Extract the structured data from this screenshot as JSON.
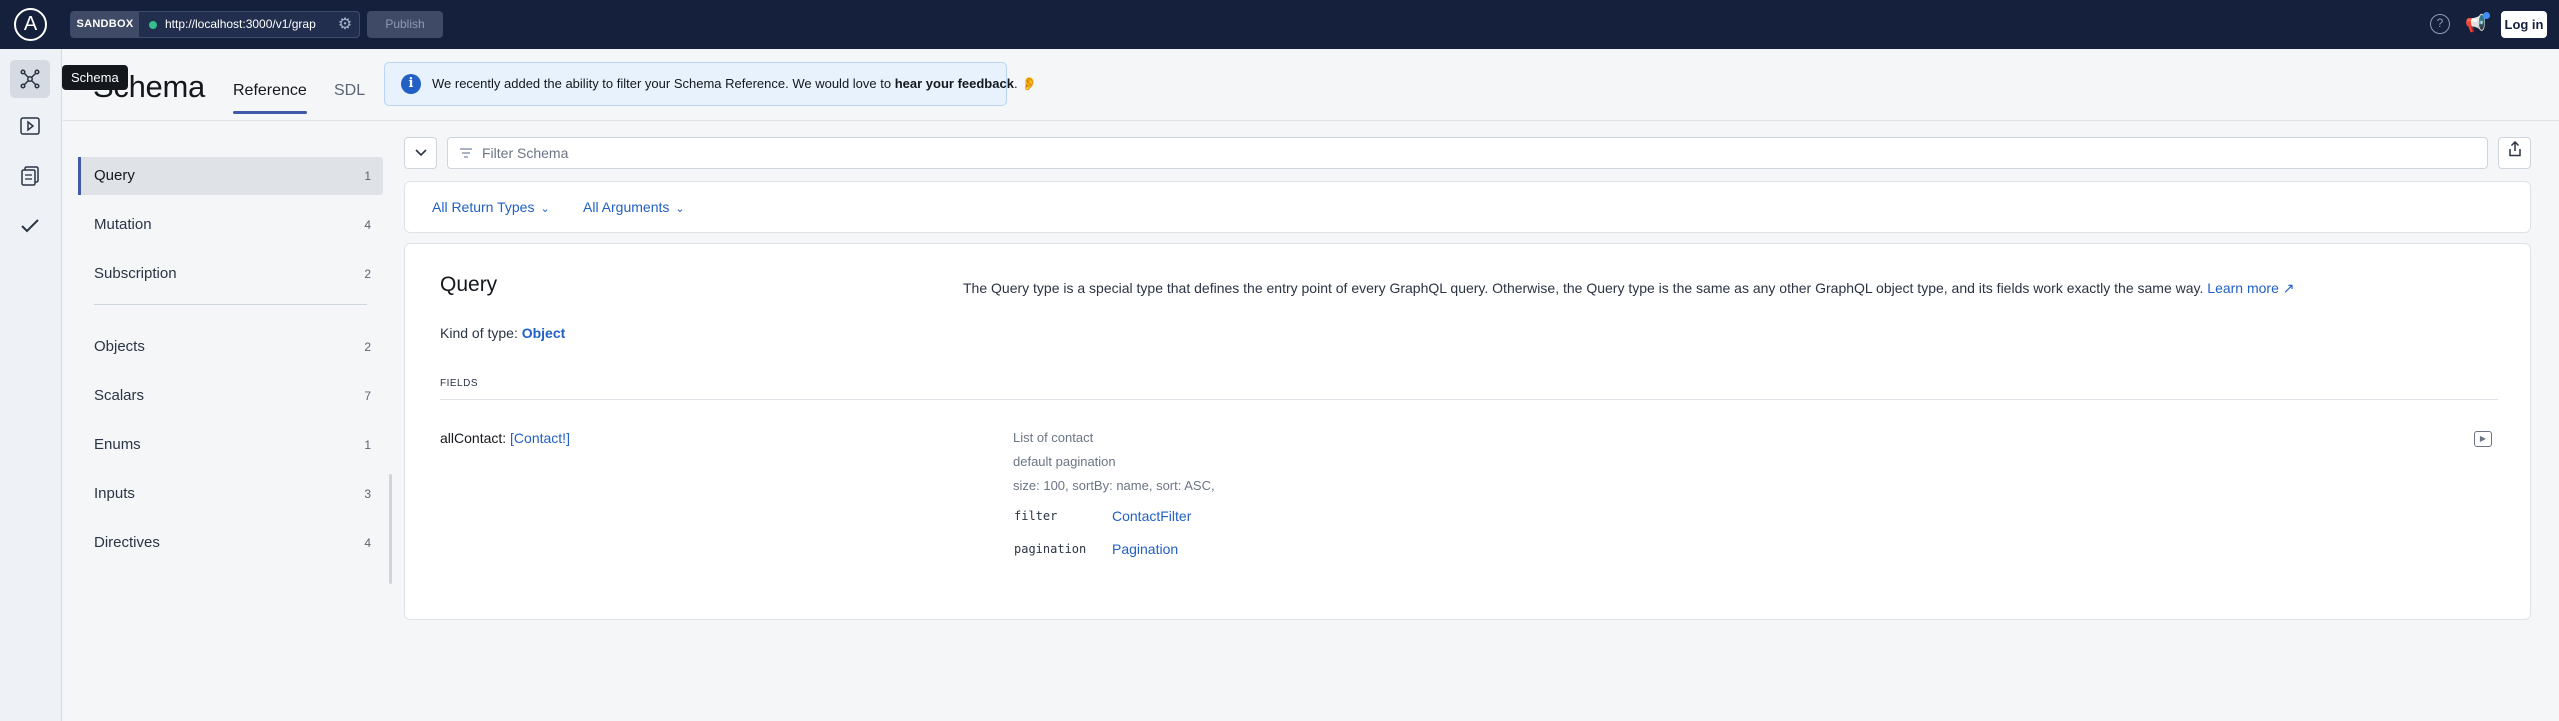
{
  "topbar": {
    "logo_letter": "A",
    "sandbox_label": "SANDBOX",
    "endpoint_url": "http://localhost:3000/v1/grap",
    "publish_label": "Publish",
    "help_glyph": "?",
    "login_label": "Log in",
    "icons": [
      "apollo-logo-icon",
      "status-dot-icon",
      "gear-icon",
      "help-icon",
      "megaphone-icon"
    ],
    "status_color": "#35c08b"
  },
  "rail": {
    "items": [
      "schema-icon",
      "explorer-play-icon",
      "documents-icon",
      "checks-icon"
    ],
    "tooltip": "Schema"
  },
  "header": {
    "title": "Schema",
    "tabs": [
      {
        "label": "Reference",
        "active": true
      },
      {
        "label": "SDL",
        "active": false
      }
    ],
    "banner": {
      "text": "We recently added the ability to filter your Schema Reference. We would love to",
      "link": "hear your feedback",
      "trailing": ".",
      "icon": "info-icon",
      "emoji": "ear"
    }
  },
  "sidebar": {
    "groups": [
      [
        {
          "label": "Query",
          "count": "1",
          "active": true
        },
        {
          "label": "Mutation",
          "count": "4"
        },
        {
          "label": "Subscription",
          "count": "2"
        }
      ],
      [
        {
          "label": "Objects",
          "count": "2"
        },
        {
          "label": "Scalars",
          "count": "7"
        },
        {
          "label": "Enums",
          "count": "1"
        },
        {
          "label": "Inputs",
          "count": "3"
        },
        {
          "label": "Directives",
          "count": "4"
        }
      ]
    ]
  },
  "filter": {
    "placeholder": "Filter Schema",
    "return_types": "All Return Types",
    "arguments": "All Arguments"
  },
  "card": {
    "title": "Query",
    "description": "The Query type is a special type that defines the entry point of every GraphQL query. Otherwise, the Query type is the same as any other GraphQL object type, and its fields work exactly the same way.",
    "learn_more": "Learn more",
    "kind_label": "Kind of type:",
    "kind_value": "Object",
    "fields_label": "FIELDS",
    "field": {
      "name": "allContact:",
      "type": "[Contact!]",
      "desc_lines": [
        "List of contact",
        "default pagination",
        "size: 100, sortBy: name, sort: ASC,"
      ],
      "args": [
        {
          "name": "filter",
          "type": "ContactFilter"
        },
        {
          "name": "pagination",
          "type": "Pagination"
        }
      ]
    }
  },
  "colors": {
    "topbar_bg": "#15203c",
    "link_blue": "#2260c5",
    "active_indicator": "#3f5aa8",
    "banner_bg": "#e8f2fd"
  }
}
